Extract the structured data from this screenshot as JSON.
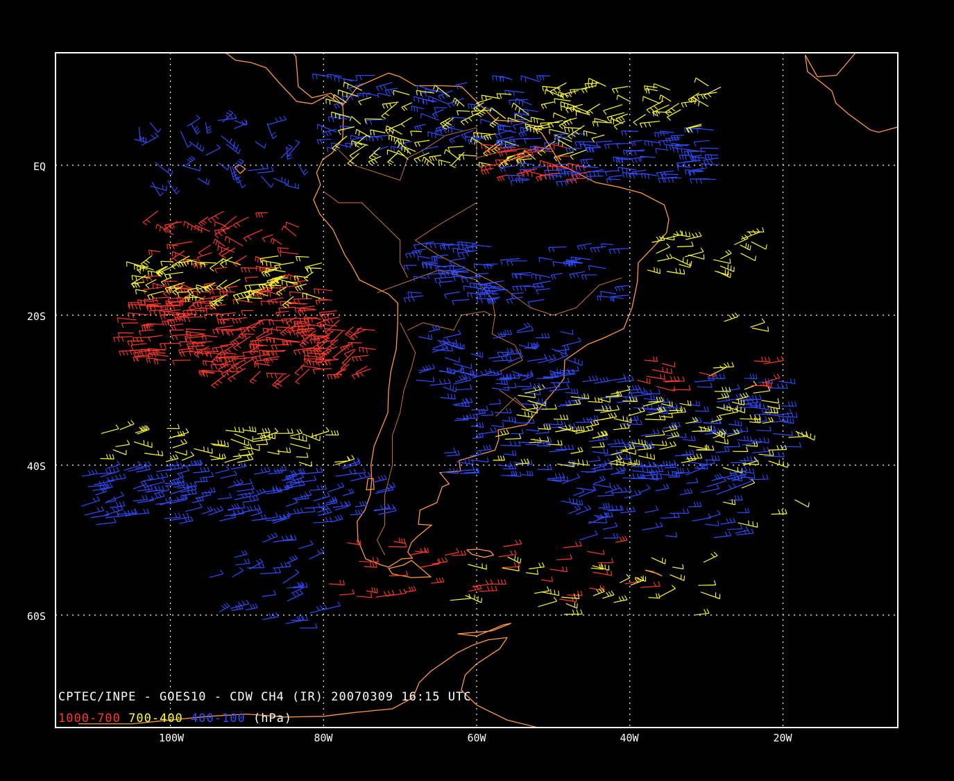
{
  "map": {
    "caption": "CPTEC/INPE - GOES10 - CDW CH4 (IR) 20070309 16:15 UTC",
    "legend": {
      "layers": [
        {
          "label": "1000-700",
          "color": "#ff3a2a"
        },
        {
          "label": "700-400",
          "color": "#ffff30"
        },
        {
          "label": "400-100",
          "color": "#2f4dff"
        }
      ],
      "unit": "(hPa)"
    },
    "lat_ticks": [
      "EQ",
      "20S",
      "40S",
      "60S"
    ],
    "lon_ticks": [
      "100W",
      "80W",
      "60W",
      "40W",
      "20W"
    ],
    "extent": {
      "lon_min": -115,
      "lon_max": -5,
      "lat_min": -75,
      "lat_max": 15
    },
    "colors": {
      "background": "#000000",
      "frame": "#ffffff",
      "coast": "#ff9a40",
      "grid": "#ffffff"
    },
    "wind_barbs": [
      {
        "layer": "low",
        "lat": -20,
        "lon": -80,
        "region": "subtropical-pacific"
      },
      {
        "layer": "mid",
        "lat": -13,
        "lon": -95,
        "region": "tropical-pacific"
      },
      {
        "layer": "high",
        "lat": -42,
        "lon": -95,
        "region": "southern-pacific"
      },
      {
        "layer": "high",
        "lat": -32,
        "lon": -50,
        "region": "south-atlantic"
      },
      {
        "layer": "high",
        "lat": 2,
        "lon": -35,
        "region": "equatorial-atlantic"
      }
    ]
  }
}
